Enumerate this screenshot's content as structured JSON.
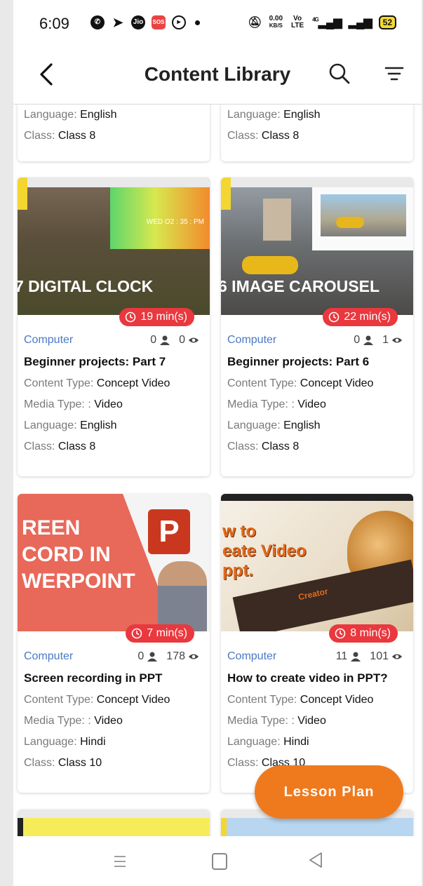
{
  "status_bar": {
    "time": "6:09",
    "net_speed": "0.00",
    "net_unit": "KB/S",
    "network_a": "Vo LTE",
    "network_b": "4G",
    "battery": "52"
  },
  "app_bar": {
    "title": "Content Library"
  },
  "labels": {
    "content_type": "Content Type:",
    "media_type": "Media Type: :",
    "language": "Language:",
    "class": "Class:"
  },
  "top_partial_cards": [
    {
      "language": "English",
      "class": "Class 8"
    },
    {
      "language": "English",
      "class": "Class 8"
    }
  ],
  "cards": [
    {
      "thumb_text": "7 DIGITAL CLOCK",
      "thumb_clock": "WED O2 : 35 : PM",
      "duration": "19 min(s)",
      "subject": "Computer",
      "users": "0",
      "views": "0",
      "title": "Beginner projects: Part 7",
      "content_type": "Concept Video",
      "media_type": "Video",
      "language": "English",
      "class": "Class 8"
    },
    {
      "thumb_text": "6 IMAGE CAROUSEL",
      "duration": "22 min(s)",
      "subject": "Computer",
      "users": "0",
      "views": "1",
      "title": "Beginner projects: Part 6",
      "content_type": "Concept Video",
      "media_type": "Video",
      "language": "English",
      "class": "Class 8"
    },
    {
      "thumb_text_lines": [
        "REEN",
        "CORD IN",
        "WERPOINT"
      ],
      "thumb_logo": "P",
      "duration": "7 min(s)",
      "subject": "Computer",
      "users": "0",
      "views": "178",
      "title": "Screen recording in PPT",
      "content_type": "Concept Video",
      "media_type": "Video",
      "language": "Hindi",
      "class": "Class 10"
    },
    {
      "thumb_text_lines": [
        "w to",
        "eate Video",
        "ppt."
      ],
      "thumb_caption": "Creator",
      "duration": "8 min(s)",
      "subject": "Computer",
      "users": "11",
      "views": "101",
      "title": "How to create video in PPT?",
      "content_type": "Concept Video",
      "media_type": "Video",
      "language": "Hindi",
      "class": "Class 10"
    }
  ],
  "fab": {
    "label": "Lesson Plan"
  },
  "colors": {
    "subject": "#4b78c6",
    "duration_badge": "#e9383e",
    "fab": "#ef7a1e"
  }
}
